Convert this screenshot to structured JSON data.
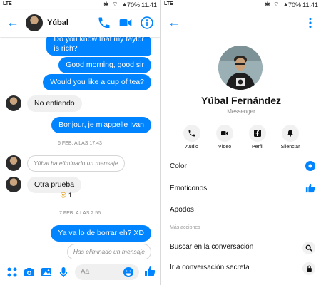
{
  "status": {
    "carrier": "LTE",
    "battery": "70%",
    "time": "11:41"
  },
  "chat": {
    "contact_name": "Yúbal",
    "messages": [
      {
        "text": "Do you know that my taylor",
        "dir": "out"
      },
      {
        "text": "is rich?",
        "dir": "out"
      },
      {
        "text": "Good morning, good sir",
        "dir": "out"
      },
      {
        "text": "Would you like a cup of tea?",
        "dir": "out"
      },
      {
        "text": "No entiendo",
        "dir": "in"
      },
      {
        "text": "Bonjour, je m'appelle Ivan",
        "dir": "out"
      },
      {
        "text": "6 FEB. A LAS 17:43",
        "dir": "time"
      },
      {
        "text": "Yúbal ha eliminado un mensaje",
        "dir": "deleted-in"
      },
      {
        "text": "Otra prueba",
        "dir": "in"
      },
      {
        "text": "1",
        "dir": "reaction-count"
      },
      {
        "text": "7 FEB. A LAS 2:56",
        "dir": "time"
      },
      {
        "text": "Ya va lo de borrar eh? XD",
        "dir": "out"
      },
      {
        "text": "Has eliminado un mensaje",
        "dir": "deleted-out"
      }
    ],
    "composer_placeholder": "Aa"
  },
  "profile": {
    "name": "Yúbal Fernández",
    "subtitle": "Messenger",
    "actions": [
      {
        "label": "Audio"
      },
      {
        "label": "Vídeo"
      },
      {
        "label": "Perfil"
      },
      {
        "label": "Silenciar"
      }
    ],
    "settings": [
      {
        "label": "Color"
      },
      {
        "label": "Emoticonos"
      },
      {
        "label": "Apodos"
      }
    ],
    "more_header": "Más acciones",
    "more": [
      {
        "label": "Buscar en la conversación"
      },
      {
        "label": "Ir a conversación secreta"
      }
    ]
  },
  "colors": {
    "accent": "#0084ff",
    "bubble_in": "#f1f0f0"
  }
}
